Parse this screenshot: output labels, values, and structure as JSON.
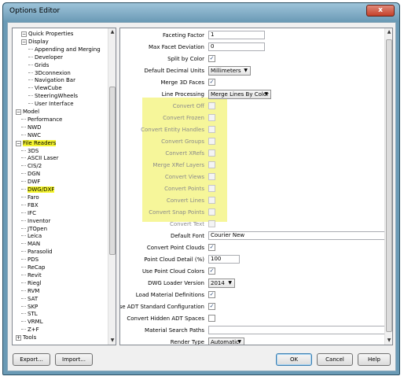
{
  "window": {
    "title": "Options Editor",
    "close_label": "x"
  },
  "tree": {
    "items": [
      {
        "label": "Quick Properties",
        "level": 1,
        "toggle": "−"
      },
      {
        "label": "Display",
        "level": 1,
        "toggle": "−"
      },
      {
        "label": "Appending and Merging",
        "level": 2
      },
      {
        "label": "Developer",
        "level": 2
      },
      {
        "label": "Grids",
        "level": 2
      },
      {
        "label": "3Dconnexion",
        "level": 2
      },
      {
        "label": "Navigation Bar",
        "level": 2
      },
      {
        "label": "ViewCube",
        "level": 2
      },
      {
        "label": "SteeringWheels",
        "level": 2
      },
      {
        "label": "User Interface",
        "level": 2
      },
      {
        "label": "Model",
        "level": 0,
        "toggle": "−"
      },
      {
        "label": "Performance",
        "level": 1
      },
      {
        "label": "NWD",
        "level": 1
      },
      {
        "label": "NWC",
        "level": 1
      },
      {
        "label": "File Readers",
        "level": 0,
        "toggle": "−",
        "highlight": true
      },
      {
        "label": "3DS",
        "level": 1
      },
      {
        "label": "ASCII Laser",
        "level": 1
      },
      {
        "label": "CIS/2",
        "level": 1
      },
      {
        "label": "DGN",
        "level": 1
      },
      {
        "label": "DWF",
        "level": 1
      },
      {
        "label": "DWG/DXF",
        "level": 1,
        "highlight": true
      },
      {
        "label": "Faro",
        "level": 1
      },
      {
        "label": "FBX",
        "level": 1
      },
      {
        "label": "IFC",
        "level": 1
      },
      {
        "label": "Inventor",
        "level": 1
      },
      {
        "label": "JTOpen",
        "level": 1
      },
      {
        "label": "Leica",
        "level": 1
      },
      {
        "label": "MAN",
        "level": 1
      },
      {
        "label": "Parasolid",
        "level": 1
      },
      {
        "label": "PDS",
        "level": 1
      },
      {
        "label": "ReCap",
        "level": 1
      },
      {
        "label": "Revit",
        "level": 1
      },
      {
        "label": "Riegl",
        "level": 1
      },
      {
        "label": "RVM",
        "level": 1
      },
      {
        "label": "SAT",
        "level": 1
      },
      {
        "label": "SKP",
        "level": 1
      },
      {
        "label": "STL",
        "level": 1
      },
      {
        "label": "VRML",
        "level": 1
      },
      {
        "label": "Z+F",
        "level": 1
      },
      {
        "label": "Tools",
        "level": 0,
        "toggle": "+"
      }
    ]
  },
  "props": {
    "faceting_factor": {
      "label": "Faceting Factor",
      "value": "1"
    },
    "max_facet_deviation": {
      "label": "Max Facet Deviation",
      "value": "0"
    },
    "split_by_color": {
      "label": "Split by Color",
      "checked": "✓"
    },
    "default_decimal_units": {
      "label": "Default Decimal Units",
      "value": "Millimeters"
    },
    "merge_3d_faces": {
      "label": "Merge 3D Faces",
      "checked": "✓"
    },
    "line_processing": {
      "label": "Line Processing",
      "value": "Merge Lines By Color"
    },
    "convert_off": {
      "label": "Convert Off"
    },
    "convert_frozen": {
      "label": "Convert Frozen"
    },
    "convert_entity_handles": {
      "label": "Convert Entity Handles"
    },
    "convert_groups": {
      "label": "Convert Groups"
    },
    "convert_xrefs": {
      "label": "Convert XRefs"
    },
    "merge_xref_layers": {
      "label": "Merge XRef Layers"
    },
    "convert_views": {
      "label": "Convert Views"
    },
    "convert_points": {
      "label": "Convert Points"
    },
    "convert_lines": {
      "label": "Convert Lines"
    },
    "convert_snap_points": {
      "label": "Convert Snap Points"
    },
    "convert_text": {
      "label": "Convert Text"
    },
    "default_font": {
      "label": "Default Font",
      "value": "Courier New"
    },
    "convert_point_clouds": {
      "label": "Convert Point Clouds",
      "checked": "✓"
    },
    "point_cloud_detail": {
      "label": "Point Cloud Detail (%)",
      "value": "100"
    },
    "use_point_cloud_colors": {
      "label": "Use Point Cloud Colors",
      "checked": "✓"
    },
    "dwg_loader_version": {
      "label": "DWG Loader Version",
      "value": "2014"
    },
    "load_material_definitions": {
      "label": "Load Material Definitions",
      "checked": "✓"
    },
    "use_adt_standard_configuration": {
      "label": "Use ADT Standard Configuration",
      "checked": "✓"
    },
    "convert_hidden_adt_spaces": {
      "label": "Convert Hidden ADT Spaces"
    },
    "material_search_paths": {
      "label": "Material Search Paths",
      "value": ""
    },
    "render_type": {
      "label": "Render Type",
      "value": "Automatic"
    }
  },
  "buttons": {
    "export": "Export...",
    "import": "Import...",
    "ok": "OK",
    "cancel": "Cancel",
    "help": "Help"
  },
  "colors": {
    "highlight": "#f6f69a",
    "title_bar": "#6f9db8",
    "close": "#c4412a"
  }
}
